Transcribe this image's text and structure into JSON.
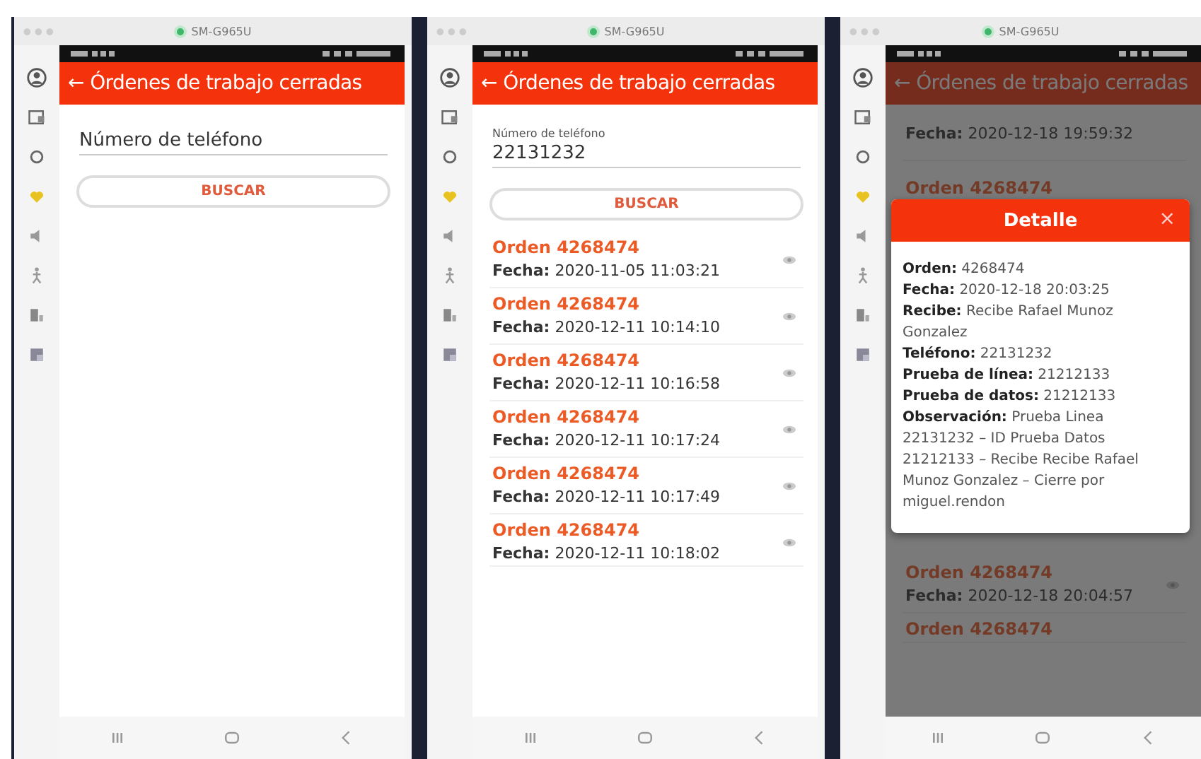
{
  "panels": [
    {
      "emulator_title": "SM-G965U",
      "app_title": "← Órdenes de trabajo cerradas",
      "phone_field": {
        "placeholder": "Número de teléfono"
      },
      "button": "BUSCAR"
    },
    {
      "emulator_title": "SM-G965U",
      "app_title": "← Órdenes de trabajo cerradas",
      "phone_field": {
        "label": "Número de teléfono",
        "value": "22131232"
      },
      "button": "BUSCAR",
      "orders": [
        {
          "orden": "Orden 4268474",
          "fecha": "**Fecha:** 2020-11-05 11:03:21"
        },
        {
          "orden": "Orden 4268474",
          "fecha": "**Fecha:** 2020-12-11 10:14:10"
        },
        {
          "orden": "Orden 4268474",
          "fecha": "**Fecha:** 2020-12-11 10:16:58"
        },
        {
          "orden": "Orden 4268474",
          "fecha": "**Fecha:** 2020-12-11 10:17:24"
        },
        {
          "orden": "Orden 4268474",
          "fecha": "**Fecha:** 2020-12-11 10:17:49"
        },
        {
          "orden": "Orden 4268474",
          "fecha": "**Fecha:** 2020-12-11 10:18:02"
        }
      ]
    },
    {
      "emulator_title": "SM-G965U",
      "app_title": "← Órdenes de trabajo cerradas",
      "orders_above": [
        {
          "fecha": "**Fecha:** 2020-12-18 19:59:32"
        },
        {
          "orden": "Orden 4268474"
        }
      ],
      "orders_below": [
        {
          "orden": "Orden 4268474",
          "fecha": "**Fecha:** 2020-12-18 20:04:57"
        },
        {
          "orden": "Orden 4268474"
        }
      ],
      "dialog": {
        "title": "Detalle",
        "close": "×",
        "lines": [
          "**Orden:** 4268474",
          "**Fecha:** 2020-12-18 20:03:25",
          "**Recibe:** Recibe Rafael Munoz Gonzalez",
          "**Teléfono:** 22131232",
          "**Prueba de línea:** 21212133",
          "**Prueba de datos:** 21212133",
          "**Observación:** Prueba Linea 22131232 – ID Prueba Datos 21212133 – Recibe Recibe Rafael Munoz Gonzalez – Cierre por miguel.rendon"
        ]
      }
    }
  ]
}
